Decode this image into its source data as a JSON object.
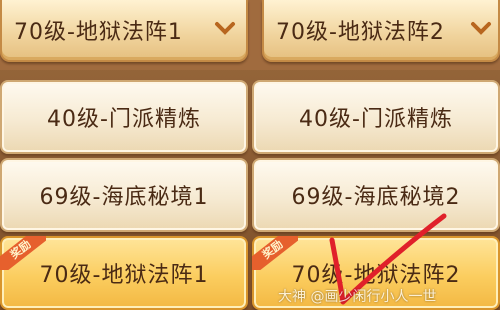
{
  "dropdowns": [
    {
      "label": "70级-地狱法阵1",
      "icon": "chevron-down-icon"
    },
    {
      "label": "70级-地狱法阵2",
      "icon": "chevron-down-icon"
    }
  ],
  "buttons": [
    {
      "label": "40级-门派精炼"
    },
    {
      "label": "40级-门派精炼"
    },
    {
      "label": "69级-海底秘境1"
    },
    {
      "label": "69级-海底秘境2"
    },
    {
      "label": "70级-地狱法阵1",
      "badge": "奖励"
    },
    {
      "label": "70级-地狱法阵2",
      "badge": "奖励"
    }
  ],
  "watermark": "大神 @画少闲行小人一世",
  "colors": {
    "accent": "#f3b843",
    "check": "#e0202a",
    "badge": "#e6602d"
  }
}
